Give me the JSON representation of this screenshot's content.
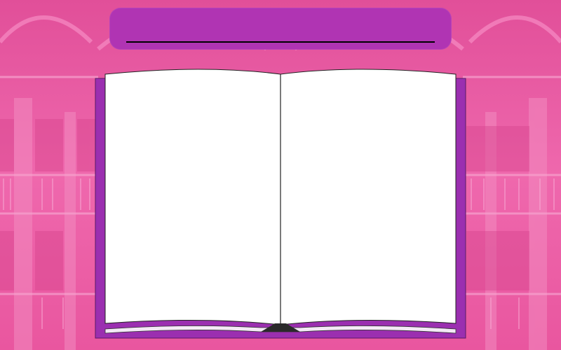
{
  "banner": {
    "title": ""
  },
  "book": {
    "left_page_text": "",
    "right_page_text": ""
  },
  "colors": {
    "background_tint": "#ec5aa6",
    "banner": "#b034b3",
    "book_cover": "#9b2fb0",
    "page": "#ffffff",
    "bookmark": "#2a2a2a"
  },
  "icons": [
    "library-background",
    "open-book-icon",
    "bookmark-icon"
  ]
}
